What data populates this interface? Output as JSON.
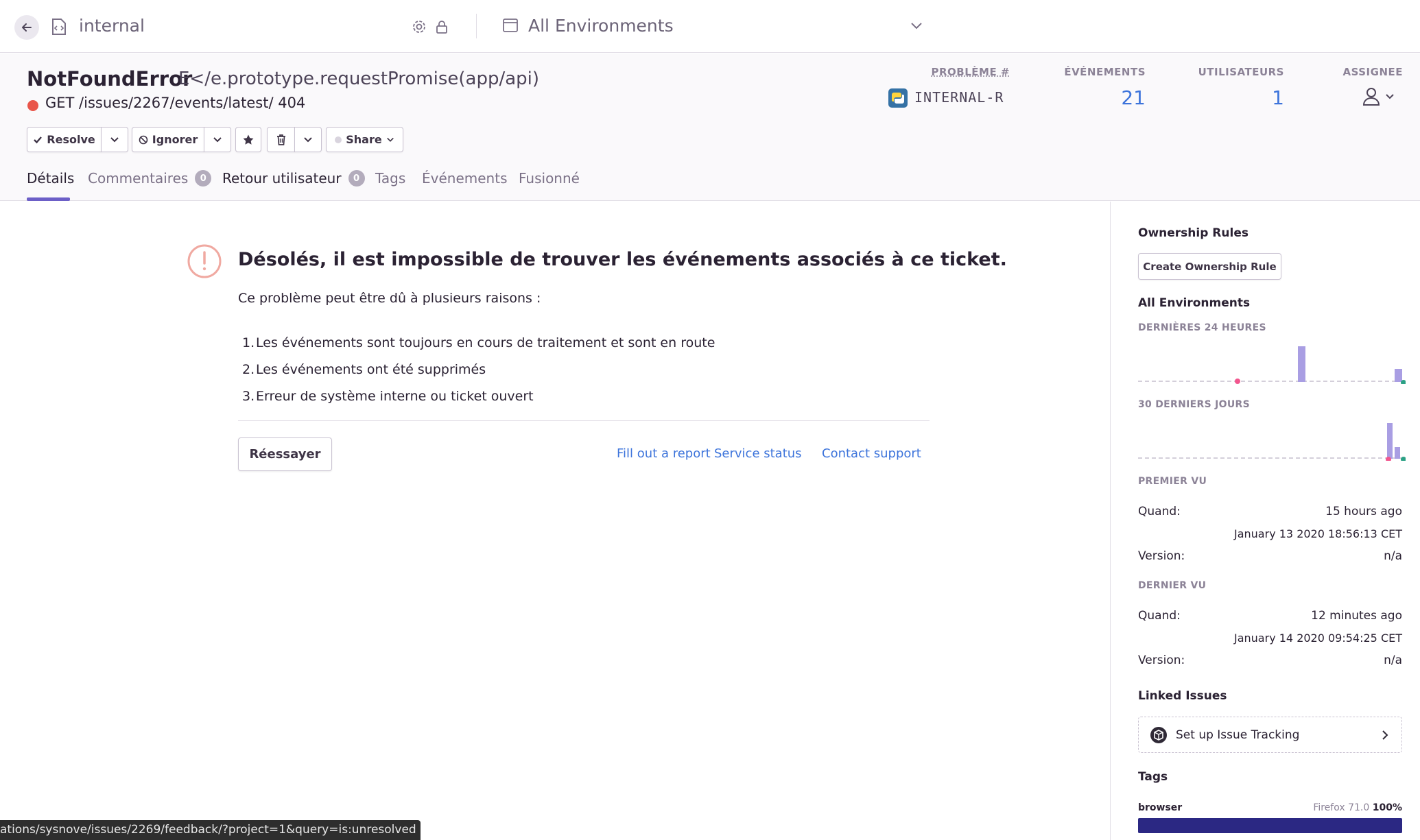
{
  "topbar": {
    "project_name": "internal",
    "environment": "All Environments"
  },
  "issue": {
    "type": "NotFoundError",
    "culprit": "E</e.prototype.requestPromise(app/api)",
    "message": "GET /issues/2267/events/latest/ 404",
    "status_color": "#e9554a"
  },
  "meta": {
    "problem_label": "PROBLÈME #",
    "short_id": "INTERNAL-R",
    "events_label": "ÉVÉNEMENTS",
    "events_value": "21",
    "users_label": "UTILISATEURS",
    "users_value": "1",
    "assignee_label": "ASSIGNEE"
  },
  "actions": {
    "resolve": "Resolve",
    "ignore": "Ignorer",
    "share": "Share"
  },
  "tabs": [
    {
      "label": "Détails"
    },
    {
      "label": "Commentaires",
      "badge": "0"
    },
    {
      "label": "Retour utilisateur",
      "badge": "0"
    },
    {
      "label": "Tags"
    },
    {
      "label": "Événements"
    },
    {
      "label": "Fusionné"
    }
  ],
  "error_panel": {
    "title": "Désolés, il est impossible de trouver les événements associés à ce ticket.",
    "subtitle": "Ce problème peut être dû à plusieurs raisons :",
    "reasons": [
      "Les événements sont toujours en cours de traitement et sont en route",
      "Les événements ont été supprimés",
      "Erreur de système interne ou ticket ouvert"
    ],
    "retry": "Réessayer",
    "links": [
      "Fill out a report",
      "Service status",
      "Contact support"
    ]
  },
  "sidebar": {
    "ownership_title": "Ownership Rules",
    "ownership_button": "Create Ownership Rule",
    "env_title": "All Environments",
    "last24_label": "DERNIÈRES 24 HEURES",
    "last30_label": "30 DERNIERS JOURS",
    "first_seen_label": "PREMIER VU",
    "first_when_key": "Quand:",
    "first_when_value": "15 hours ago",
    "first_date": "January 13 2020 18:56:13 CET",
    "first_version_key": "Version:",
    "first_version_value": "n/a",
    "last_seen_label": "DERNIER VU",
    "last_when_key": "Quand:",
    "last_when_value": "12 minutes ago",
    "last_date": "January 14 2020 09:54:25 CET",
    "last_version_key": "Version:",
    "last_version_value": "n/a",
    "linked_title": "Linked Issues",
    "issue_tracking": "Set up Issue Tracking",
    "tags_title": "Tags",
    "tag_key": "browser",
    "tag_value": "Firefox 71.0",
    "tag_percent": "100%",
    "tag_fraction": 1.0
  },
  "status_url": "ations/sysnove/issues/2269/feedback/?project=1&query=is:unresolved",
  "colors": {
    "accent": "#6c5fc7",
    "link": "#3d74db",
    "spark_bar": "#a99ee3",
    "tag_bar": "#2b2883"
  }
}
